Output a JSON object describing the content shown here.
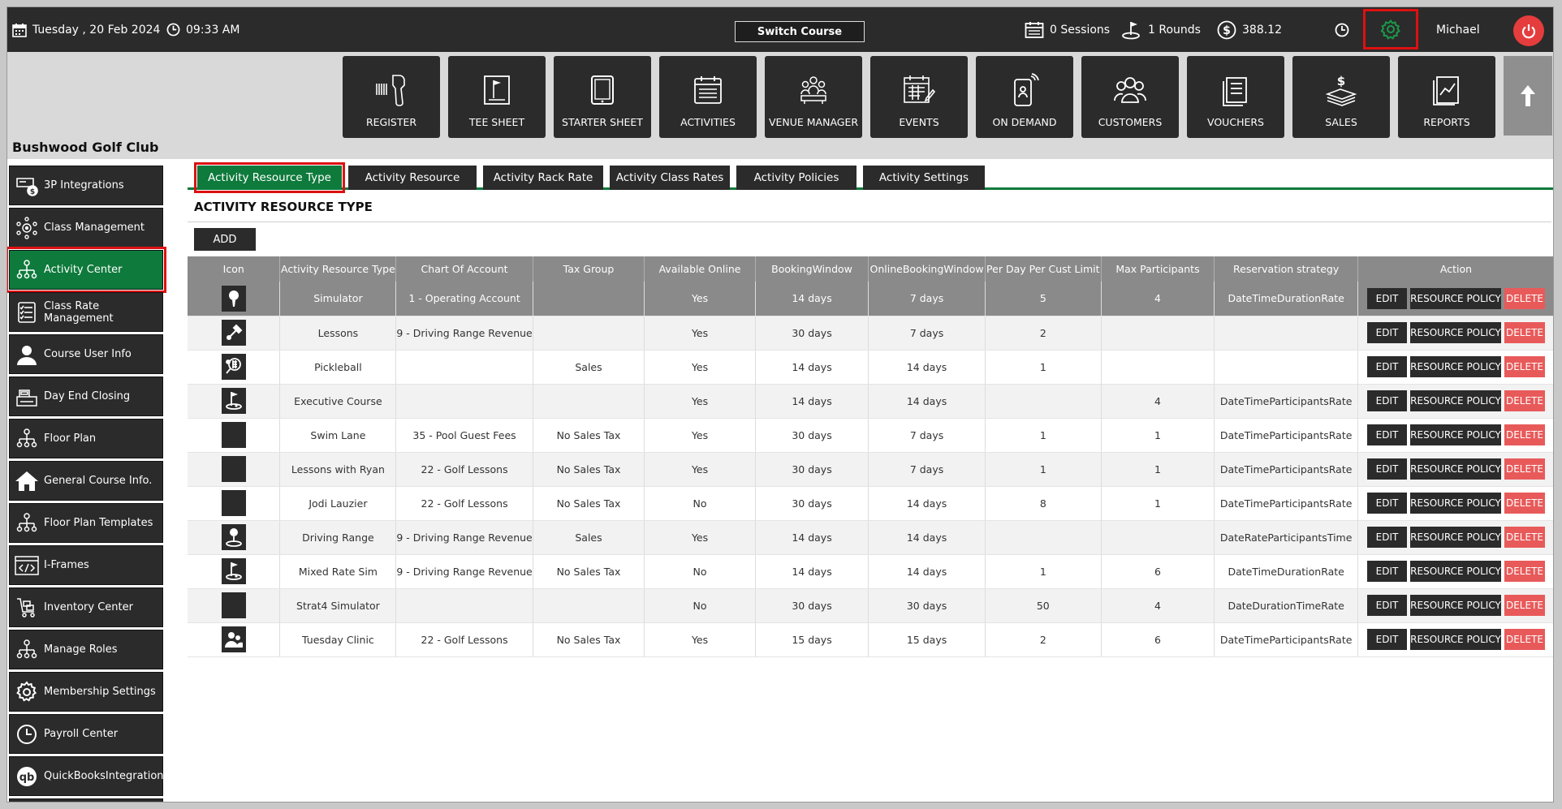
{
  "topbar": {
    "date": "Tuesday ,  20 Feb 2024",
    "time": "09:33 AM",
    "switch_course": "Switch Course",
    "sessions": "0 Sessions",
    "rounds": "1 Rounds",
    "balance": "388.12",
    "user": "Michael"
  },
  "club_name": "Bushwood Golf Club",
  "tiles": [
    "REGISTER",
    "TEE SHEET",
    "STARTER SHEET",
    "ACTIVITIES",
    "VENUE MANAGER",
    "EVENTS",
    "ON DEMAND",
    "CUSTOMERS",
    "VOUCHERS",
    "SALES",
    "REPORTS"
  ],
  "sidebar": [
    {
      "label": "3P Integrations",
      "icon": "integrations-icon"
    },
    {
      "label": "Class Management",
      "icon": "class-management-icon"
    },
    {
      "label": "Activity  Center",
      "icon": "activity-center-icon",
      "active": true
    },
    {
      "label": "Class Rate Management",
      "icon": "rate-list-icon"
    },
    {
      "label": "Course User Info",
      "icon": "user-icon"
    },
    {
      "label": "Day End Closing",
      "icon": "cash-register-icon"
    },
    {
      "label": "Floor Plan",
      "icon": "floor-plan-icon"
    },
    {
      "label": "General Course Info.",
      "icon": "home-icon"
    },
    {
      "label": "Floor Plan Templates",
      "icon": "floor-plan-templates-icon"
    },
    {
      "label": "I-Frames",
      "icon": "code-icon"
    },
    {
      "label": "Inventory Center",
      "icon": "inventory-icon"
    },
    {
      "label": "Manage Roles",
      "icon": "roles-icon"
    },
    {
      "label": "Membership Settings",
      "icon": "settings-icon"
    },
    {
      "label": "Payroll Center",
      "icon": "clock-icon"
    },
    {
      "label": "QuickBooksIntegration",
      "icon": "quickbooks-icon"
    }
  ],
  "tabs": [
    "Activity Resource Type",
    "Activity Resource",
    "Activity Rack Rate",
    "Activity Class Rates",
    "Activity Policies",
    "Activity Settings"
  ],
  "section_title": "ACTIVITY RESOURCE TYPE",
  "add_label": "ADD",
  "table": {
    "headers": [
      "Icon",
      "Activity Resource Type",
      "Chart Of Account",
      "Tax Group",
      "Available Online",
      "BookingWindow",
      "OnlineBookingWindow",
      "Per Day Per Cust Limit",
      "Max Participants",
      "Reservation strategy",
      "Action"
    ],
    "actions": {
      "edit": "EDIT",
      "policy": "RESOURCE POLICY",
      "delete": "DELETE"
    },
    "rows": [
      {
        "icon": "golf-ball-icon",
        "type": "Simulator",
        "account": "1 - Operating Account",
        "tax": "",
        "online": "Yes",
        "booking": "14 days",
        "online_booking": "7 days",
        "limit": "5",
        "max": "4",
        "strategy": "DateTimeDurationRate"
      },
      {
        "icon": "lessons-icon",
        "type": "Lessons",
        "account": "9 - Driving Range Revenue",
        "tax": "",
        "online": "Yes",
        "booking": "30 days",
        "online_booking": "7 days",
        "limit": "2",
        "max": "",
        "strategy": ""
      },
      {
        "icon": "pickleball-icon",
        "type": "Pickleball",
        "account": "",
        "tax": "Sales",
        "online": "Yes",
        "booking": "14 days",
        "online_booking": "14 days",
        "limit": "1",
        "max": "",
        "strategy": ""
      },
      {
        "icon": "golf-flag-icon",
        "type": "Executive Course",
        "account": "",
        "tax": "",
        "online": "Yes",
        "booking": "14 days",
        "online_booking": "14 days",
        "limit": "",
        "max": "4",
        "strategy": "DateTimeParticipantsRate"
      },
      {
        "icon": "blank-icon",
        "type": "Swim Lane",
        "account": "35 - Pool Guest Fees",
        "tax": "No Sales Tax",
        "online": "Yes",
        "booking": "30 days",
        "online_booking": "7 days",
        "limit": "1",
        "max": "1",
        "strategy": "DateTimeParticipantsRate"
      },
      {
        "icon": "blank-icon",
        "type": "Lessons with Ryan",
        "account": "22 - Golf Lessons",
        "tax": "No Sales Tax",
        "online": "Yes",
        "booking": "30 days",
        "online_booking": "7 days",
        "limit": "1",
        "max": "1",
        "strategy": "DateTimeParticipantsRate"
      },
      {
        "icon": "blank-icon",
        "type": "Jodi Lauzier",
        "account": "22 - Golf Lessons",
        "tax": "No Sales Tax",
        "online": "No",
        "booking": "30 days",
        "online_booking": "14 days",
        "limit": "8",
        "max": "1",
        "strategy": "DateTimeParticipantsRate"
      },
      {
        "icon": "driving-range-icon",
        "type": "Driving Range",
        "account": "9 - Driving Range Revenue",
        "tax": "Sales",
        "online": "Yes",
        "booking": "14 days",
        "online_booking": "14 days",
        "limit": "",
        "max": "",
        "strategy": "DateRateParticipantsTime"
      },
      {
        "icon": "golf-flag-icon",
        "type": "Mixed Rate Sim",
        "account": "9 - Driving Range Revenue",
        "tax": "No Sales Tax",
        "online": "No",
        "booking": "14 days",
        "online_booking": "14 days",
        "limit": "1",
        "max": "6",
        "strategy": "DateTimeDurationRate"
      },
      {
        "icon": "blank-icon",
        "type": "Strat4 Simulator",
        "account": "",
        "tax": "",
        "online": "No",
        "booking": "30 days",
        "online_booking": "30 days",
        "limit": "50",
        "max": "4",
        "strategy": "DateDurationTimeRate"
      },
      {
        "icon": "people-icon",
        "type": "Tuesday Clinic",
        "account": "22 - Golf Lessons",
        "tax": "No Sales Tax",
        "online": "Yes",
        "booking": "15 days",
        "online_booking": "15 days",
        "limit": "2",
        "max": "6",
        "strategy": "DateTimeParticipantsRate"
      }
    ]
  }
}
